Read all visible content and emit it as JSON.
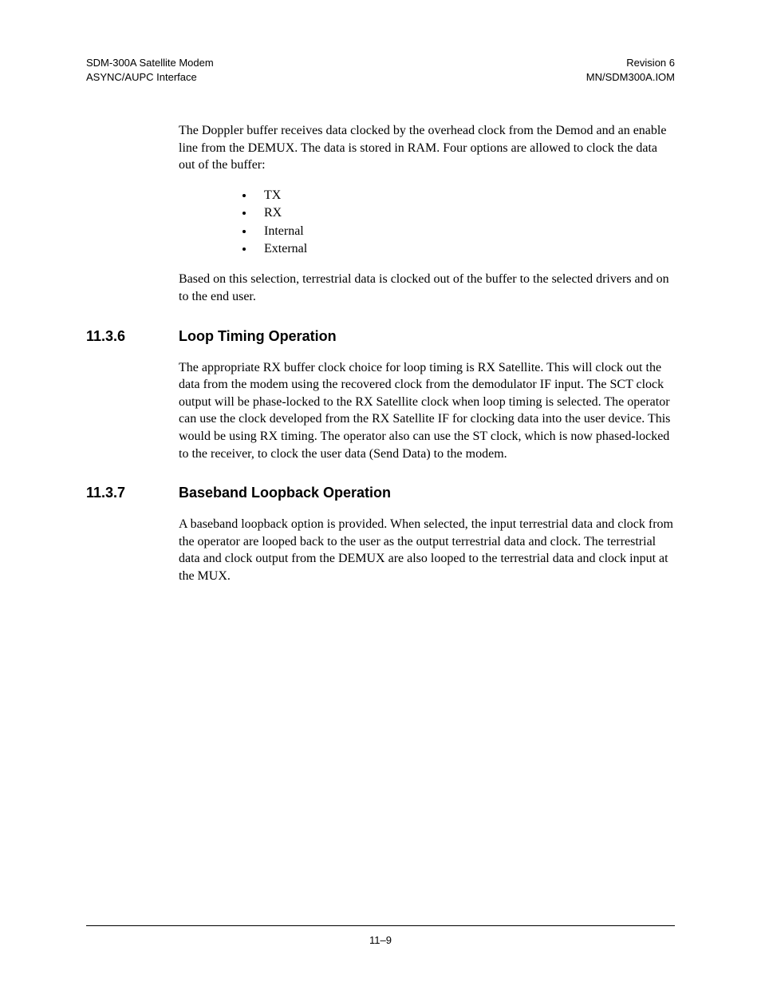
{
  "header": {
    "left_line1": "SDM-300A Satellite Modem",
    "left_line2": "ASYNC/AUPC Interface",
    "right_line1": "Revision 6",
    "right_line2": "MN/SDM300A.IOM"
  },
  "intro_para": "The Doppler buffer receives data clocked by the overhead clock from the Demod and an enable line from the DEMUX. The data is stored in RAM. Four options are allowed to clock the data out of the buffer:",
  "bullets": [
    "TX",
    "RX",
    "Internal",
    "External"
  ],
  "after_bullets": "Based on this selection, terrestrial data is clocked out of the buffer to the selected drivers and on to the end user.",
  "section1": {
    "num": "11.3.6",
    "title": "Loop Timing Operation",
    "para": "The appropriate RX buffer clock choice for loop timing is RX Satellite. This will clock out the data from the modem using the recovered clock from the demodulator IF input. The SCT clock output will be phase-locked to the RX Satellite clock when loop timing is selected. The operator can use the clock developed from the RX Satellite IF for clocking data into the user device. This would be using RX timing. The operator also can use the ST clock, which is now phased-locked to the receiver, to clock the user data (Send Data) to the modem."
  },
  "section2": {
    "num": "11.3.7",
    "title": "Baseband Loopback Operation",
    "para": "A baseband loopback option is provided. When selected, the input terrestrial data and clock from the operator are looped back to the user as the output terrestrial data and clock. The terrestrial data and clock output from the DEMUX are also looped to the terrestrial data and clock input at the MUX."
  },
  "footer": {
    "page_num": "11–9"
  }
}
